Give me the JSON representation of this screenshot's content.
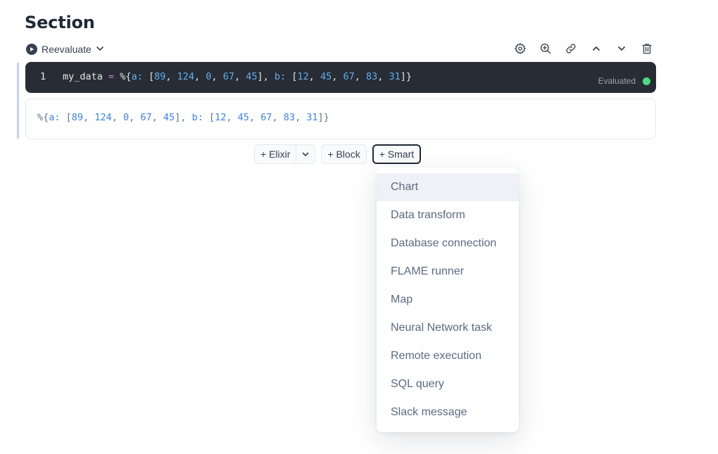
{
  "section": {
    "title": "Section"
  },
  "reevaluate": {
    "label": "Reevaluate"
  },
  "toolbar": {
    "icons": [
      "settings-icon",
      "zoom-in-icon",
      "link-icon",
      "chevron-up-icon",
      "chevron-down-icon",
      "trash-icon"
    ]
  },
  "code_cell": {
    "line_number": "1",
    "tokens": {
      "var": "my_data",
      "eq": " = ",
      "open": "%{",
      "key_a": "a:",
      "list_a_open": " [",
      "a1": "89",
      "a2": "124",
      "a3": "0",
      "a4": "67",
      "a5": "45",
      "comma": ", ",
      "list_close": "],",
      "key_b": " b:",
      "list_b_open": " [",
      "b1": "12",
      "b2": "45",
      "b3": "67",
      "b4": "83",
      "b5": "31",
      "close": "]}"
    },
    "status_label": "Evaluated",
    "status_color": "#4ade80"
  },
  "output": {
    "open": "%{",
    "key_a": "a:",
    "list_a_open": " [",
    "a1": "89",
    "a2": "124",
    "a3": "0",
    "a4": "67",
    "a5": "45",
    "comma": ", ",
    "list_close": "],",
    "key_b": " b:",
    "list_b_open": " [",
    "b1": "12",
    "b2": "45",
    "b3": "67",
    "b4": "83",
    "b5": "31",
    "close": "]}"
  },
  "insert_bar": {
    "elixir_label": "+ Elixir",
    "block_label": "+ Block",
    "smart_label": "+ Smart"
  },
  "smart_menu": {
    "items": [
      {
        "label": "Chart"
      },
      {
        "label": "Data transform"
      },
      {
        "label": "Database connection"
      },
      {
        "label": "FLAME runner"
      },
      {
        "label": "Map"
      },
      {
        "label": "Neural Network task"
      },
      {
        "label": "Remote execution"
      },
      {
        "label": "SQL query"
      },
      {
        "label": "Slack message"
      }
    ]
  }
}
